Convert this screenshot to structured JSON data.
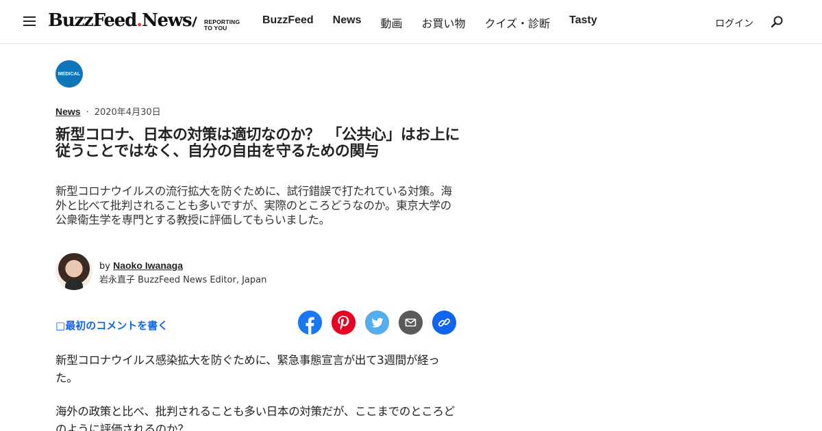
{
  "header": {
    "brand_main": "BuzzFeed",
    "brand_dot": ".",
    "brand_sub": "News",
    "slash": "/",
    "tagline_line1": "REPORTING",
    "tagline_line2": "TO YOU",
    "nav": [
      {
        "label": "BuzzFeed",
        "bold": true
      },
      {
        "label": "News",
        "bold": true
      },
      {
        "label": "動画",
        "bold": false
      },
      {
        "label": "お買い物",
        "bold": false
      },
      {
        "label": "クイズ・診断",
        "bold": false
      },
      {
        "label": "Tasty",
        "bold": true
      }
    ],
    "login": "ログイン"
  },
  "article": {
    "badge": "MEDICAL",
    "category": "News",
    "separator": "·",
    "date": "2020年4月30日",
    "headline": "新型コロナ、日本の対策は適切なのか？　「公共心」はお上に従うことではなく、自分の自由を守るための関与",
    "dek": "新型コロナウイルスの流行拡大を防ぐために、試行錯誤で打たれている対策。海外と比べて批判されることも多いですが、実際のところどうなのか。東京大学の公衆衛生学を専門とする教授に評価してもらいました。",
    "by": "by",
    "author": "Naoko Iwanaga",
    "author_role": "岩永直子 BuzzFeed News Editor, Japan",
    "comment_cta": "最初のコメントを書く",
    "comment_glyph": "□",
    "paragraphs": [
      "新型コロナウイルス感染拡大を防ぐために、緊急事態宣言が出て3週間が経った。",
      "海外の政策と比べ、批判されることも多い日本の対策だが、ここまでのところどのように評価されるのか？"
    ]
  },
  "share": [
    {
      "name": "facebook",
      "color": "#1877f2"
    },
    {
      "name": "pinterest",
      "color": "#e60023"
    },
    {
      "name": "twitter",
      "color": "#55acee"
    },
    {
      "name": "email",
      "color": "#5a5a5a"
    },
    {
      "name": "copy-link",
      "color": "#0f65ef"
    }
  ]
}
